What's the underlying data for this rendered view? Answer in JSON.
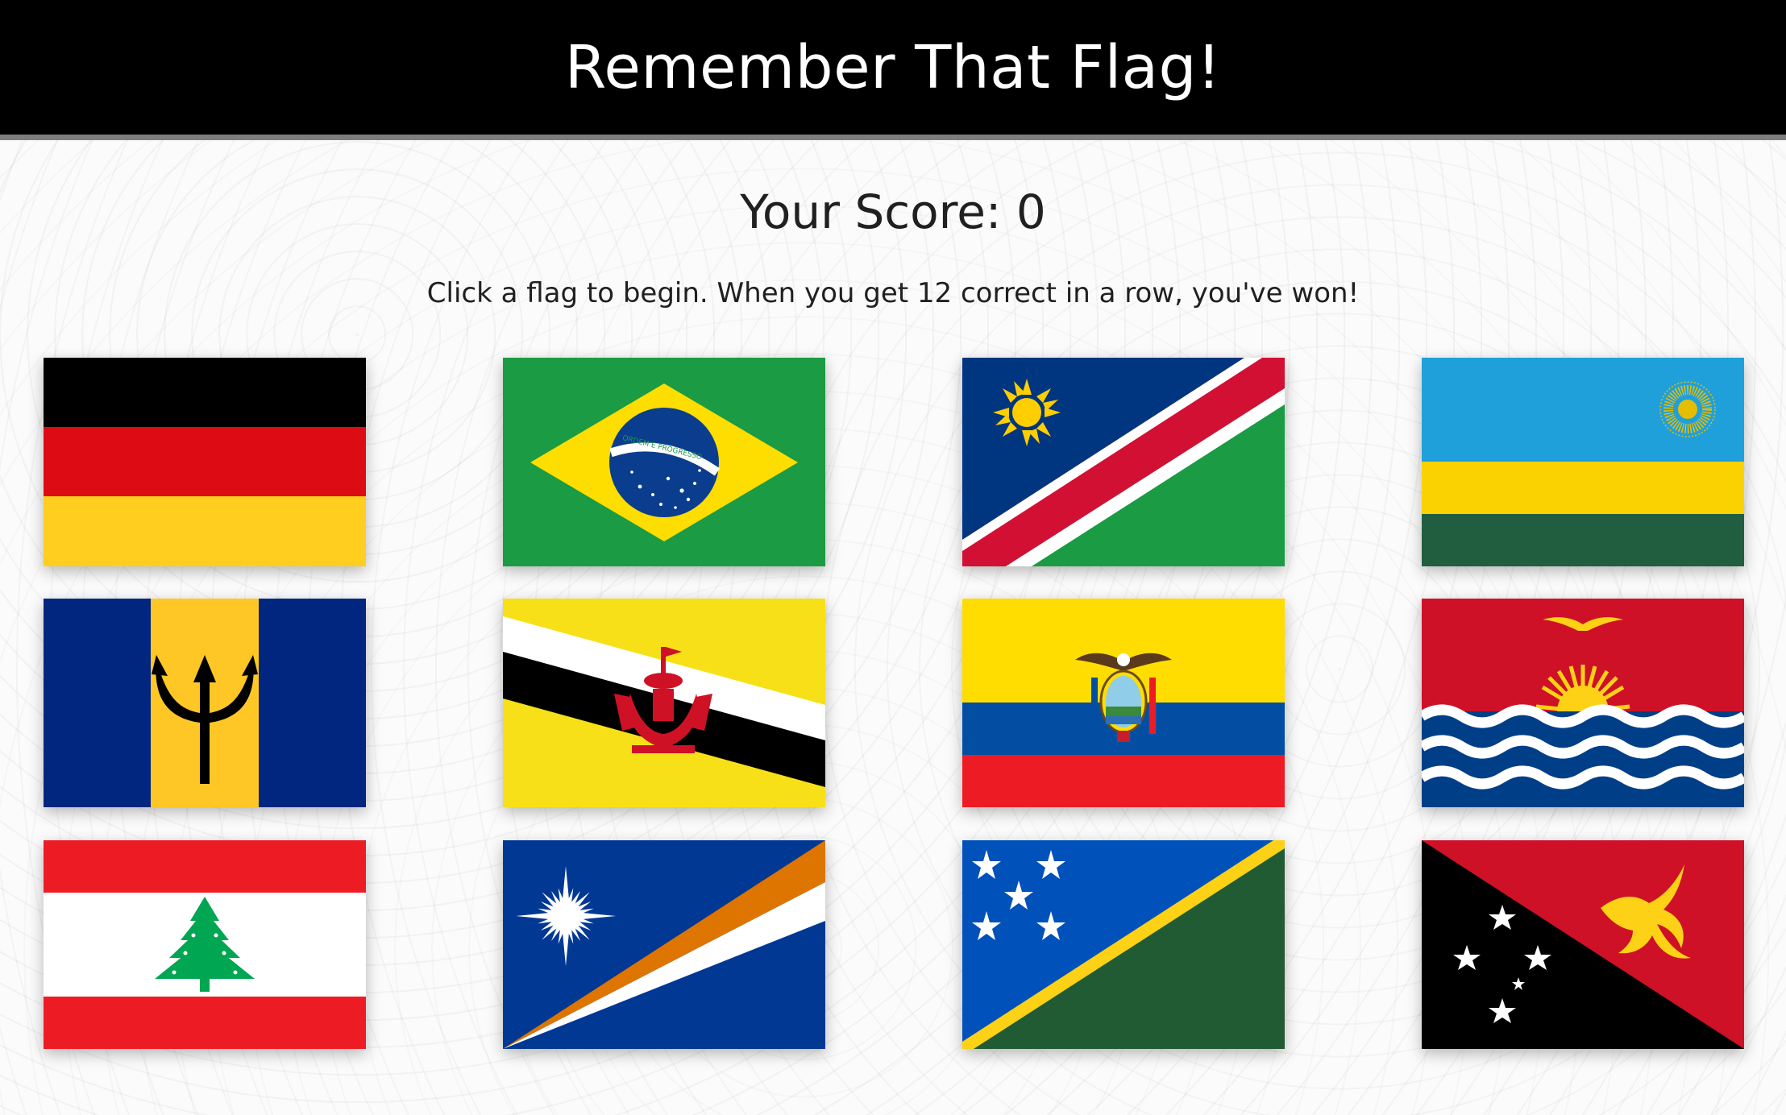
{
  "app": {
    "title": "Remember That Flag!"
  },
  "game": {
    "score_text": "Your Score: 0",
    "score": 0,
    "instructions": "Click a flag to begin. When you get 12 correct in a row, you've won!"
  },
  "flags": [
    {
      "name": "germany-flag"
    },
    {
      "name": "brazil-flag",
      "motto": "ORDEM E PROGRESSO"
    },
    {
      "name": "namibia-flag"
    },
    {
      "name": "rwanda-flag"
    },
    {
      "name": "barbados-flag"
    },
    {
      "name": "brunei-flag"
    },
    {
      "name": "ecuador-flag"
    },
    {
      "name": "kiribati-flag"
    },
    {
      "name": "lebanon-flag"
    },
    {
      "name": "marshall-islands-flag"
    },
    {
      "name": "solomon-islands-flag"
    },
    {
      "name": "papua-new-guinea-flag"
    }
  ],
  "colors": {
    "header_bg": "#000000",
    "header_text": "#ffffff",
    "header_border": "#7d7d7d",
    "text": "#202020"
  }
}
